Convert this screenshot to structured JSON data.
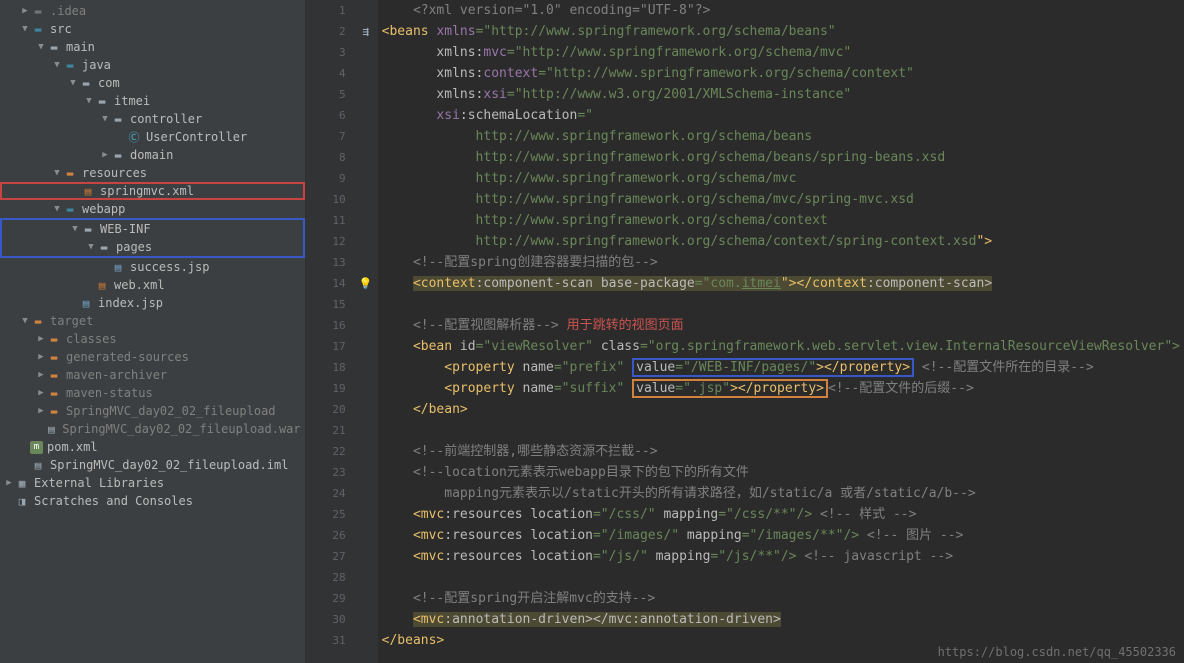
{
  "tree": {
    "idea": ".idea",
    "src": "src",
    "main": "main",
    "java": "java",
    "com": "com",
    "itmei": "itmei",
    "controller": "controller",
    "usercontroller": "UserController",
    "domain": "domain",
    "resources": "resources",
    "springmvc": "springmvc.xml",
    "webapp": "webapp",
    "webinf": "WEB-INF",
    "pages": "pages",
    "success": "success.jsp",
    "webxml": "web.xml",
    "indexjsp": "index.jsp",
    "target": "target",
    "classes": "classes",
    "generated": "generated-sources",
    "archiver": "maven-archiver",
    "status": "maven-status",
    "fileupload": "SpringMVC_day02_02_fileupload",
    "war": "SpringMVC_day02_02_fileupload.war",
    "pom": "pom.xml",
    "iml": "SpringMVC_day02_02_fileupload.iml",
    "ext": "External Libraries",
    "scratch": "Scratches and Consoles"
  },
  "code": {
    "l1": "    <?xml version=\"1.0\" encoding=\"UTF-8\"?>",
    "l2_a": "<beans ",
    "l2_b": "xmlns",
    "l2_c": "=\"http://www.springframework.org/schema/beans\"",
    "l3_a": "       xmlns:",
    "l3_b": "mvc",
    "l3_c": "=\"http://www.springframework.org/schema/mvc\"",
    "l4_a": "       xmlns:",
    "l4_b": "context",
    "l4_c": "=\"http://www.springframework.org/schema/context\"",
    "l5_a": "       xmlns:",
    "l5_b": "xsi",
    "l5_c": "=\"http://www.w3.org/2001/XMLSchema-instance\"",
    "l6_a": "       xsi",
    "l6_b": ":schemaLocation",
    "l6_c": "=\"",
    "l7": "            http://www.springframework.org/schema/beans",
    "l8": "            http://www.springframework.org/schema/beans/spring-beans.xsd",
    "l9": "            http://www.springframework.org/schema/mvc",
    "l10": "            http://www.springframework.org/schema/mvc/spring-mvc.xsd",
    "l11": "            http://www.springframework.org/schema/context",
    "l12_a": "            http://www.springframework.org/schema/context/spring-context.xsd",
    "l12_b": "\">",
    "l13": "    <!--配置spring创建容器要扫描的包-->",
    "l14_a": "    ",
    "l14_b": "<context",
    "l14_c": ":component-scan ",
    "l14_d": "base-package",
    "l14_e": "=\"com.",
    "l14_f": "itmei",
    "l14_g": "\"></context",
    "l14_h": ":component-scan>",
    "l16_a": "    <!--配置视图解析器--> ",
    "l16_b": "用于跳转的视图页面",
    "l17_a": "    <bean ",
    "l17_b": "id",
    "l17_c": "=\"viewResolver\" ",
    "l17_d": "class",
    "l17_e": "=\"org.springframework.web.servlet.view.InternalResourceViewResolver\">",
    "l18_a": "        <property ",
    "l18_b": "name",
    "l18_c": "=\"prefix\" ",
    "l18_d": "value",
    "l18_e": "=\"/WEB-INF/pages/\"",
    "l18_f": "></property>",
    "l18_g": " <!--配置文件所在的目录-->",
    "l19_a": "        <property ",
    "l19_b": "name",
    "l19_c": "=\"suffix\" ",
    "l19_d": "value",
    "l19_e": "=\".jsp\"",
    "l19_f": "></property>",
    "l19_g": "<!--配置文件的后缀-->",
    "l20": "    </bean>",
    "l22": "    <!--前端控制器,哪些静态资源不拦截-->",
    "l23": "    <!--location元素表示webapp目录下的包下的所有文件",
    "l24": "        mapping元素表示以/static开头的所有请求路径，如/static/a 或者/static/a/b-->",
    "l25_a": "    <mvc",
    "l25_b": ":resources ",
    "l25_c": "location",
    "l25_d": "=\"/css/\" ",
    "l25_e": "mapping",
    "l25_f": "=\"/css/**\"/>",
    "l25_g": " <!-- 样式 -->",
    "l26_a": "    <mvc",
    "l26_b": ":resources ",
    "l26_c": "location",
    "l26_d": "=\"/images/\" ",
    "l26_e": "mapping",
    "l26_f": "=\"/images/**\"/>",
    "l26_g": " <!-- 图片 -->",
    "l27_a": "    <mvc",
    "l27_b": ":resources ",
    "l27_c": "location",
    "l27_d": "=\"/js/\" ",
    "l27_e": "mapping",
    "l27_f": "=\"/js/**\"/>",
    "l27_g": " <!-- javascript -->",
    "l29": "    <!--配置spring开启注解mvc的支持-->",
    "l30_a": "    ",
    "l30_b": "<mvc",
    "l30_c": ":annotation-driven></mvc",
    "l30_d": ":annotation-driven>",
    "l31": "</beans>"
  },
  "watermark": "https://blog.csdn.net/qq_45502336"
}
